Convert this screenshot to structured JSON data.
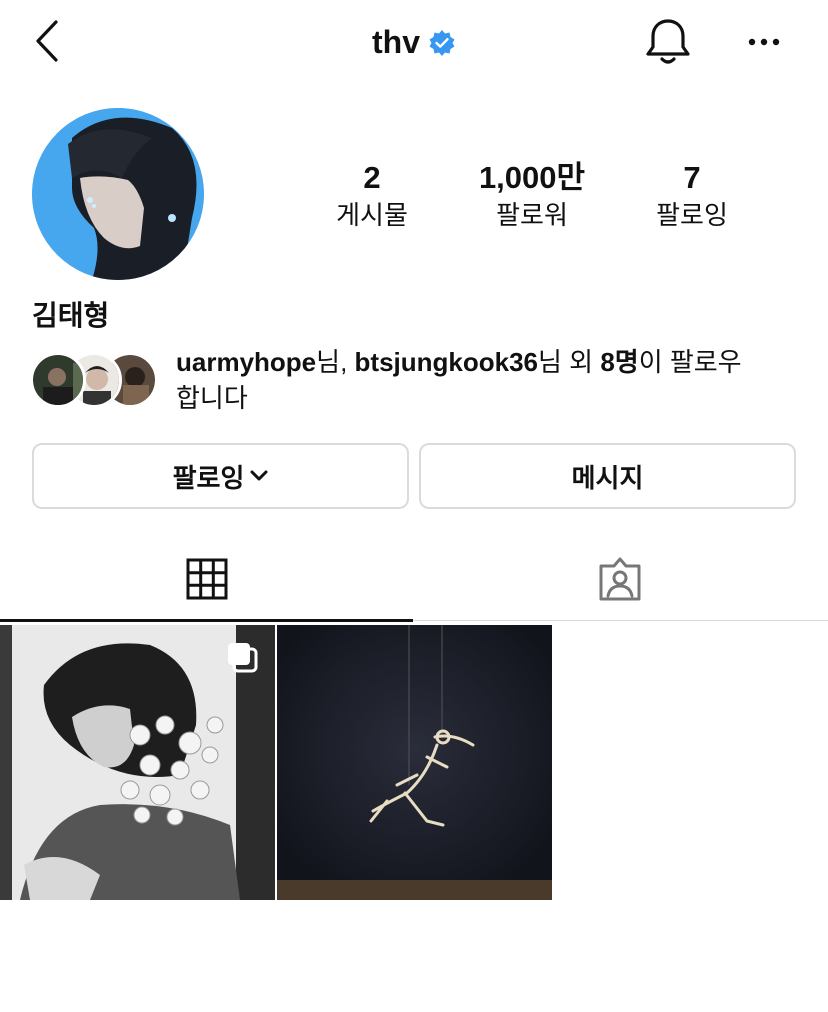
{
  "header": {
    "username": "thv",
    "back_icon": "chevron-left-icon",
    "verified_icon": "verified-badge-icon",
    "bell_icon": "bell-icon",
    "more_icon": "more-horizontal-icon",
    "verified_color": "#3897f0"
  },
  "profile": {
    "full_name": "김태형",
    "stats": [
      {
        "value": "2",
        "label": "게시물"
      },
      {
        "value": "1,000만",
        "label": "팔로워"
      },
      {
        "value": "7",
        "label": "팔로잉"
      }
    ]
  },
  "followed_by": {
    "user1": "uarmyhope",
    "suffix1": "님, ",
    "user2": "btsjungkook36",
    "suffix2": "님 외 ",
    "count": "8명",
    "suffix3": "이 팔로우",
    "line2": "합니다"
  },
  "actions": {
    "following_label": "팔로잉",
    "following_chevron": "chevron-down-icon",
    "message_label": "메시지"
  },
  "tabs": [
    {
      "icon": "grid-icon",
      "active": true
    },
    {
      "icon": "tagged-person-icon",
      "active": false
    }
  ],
  "posts": [
    {
      "type": "photo",
      "multi": true,
      "multi_icon": "carousel-icon"
    },
    {
      "type": "photo",
      "multi": false
    }
  ]
}
